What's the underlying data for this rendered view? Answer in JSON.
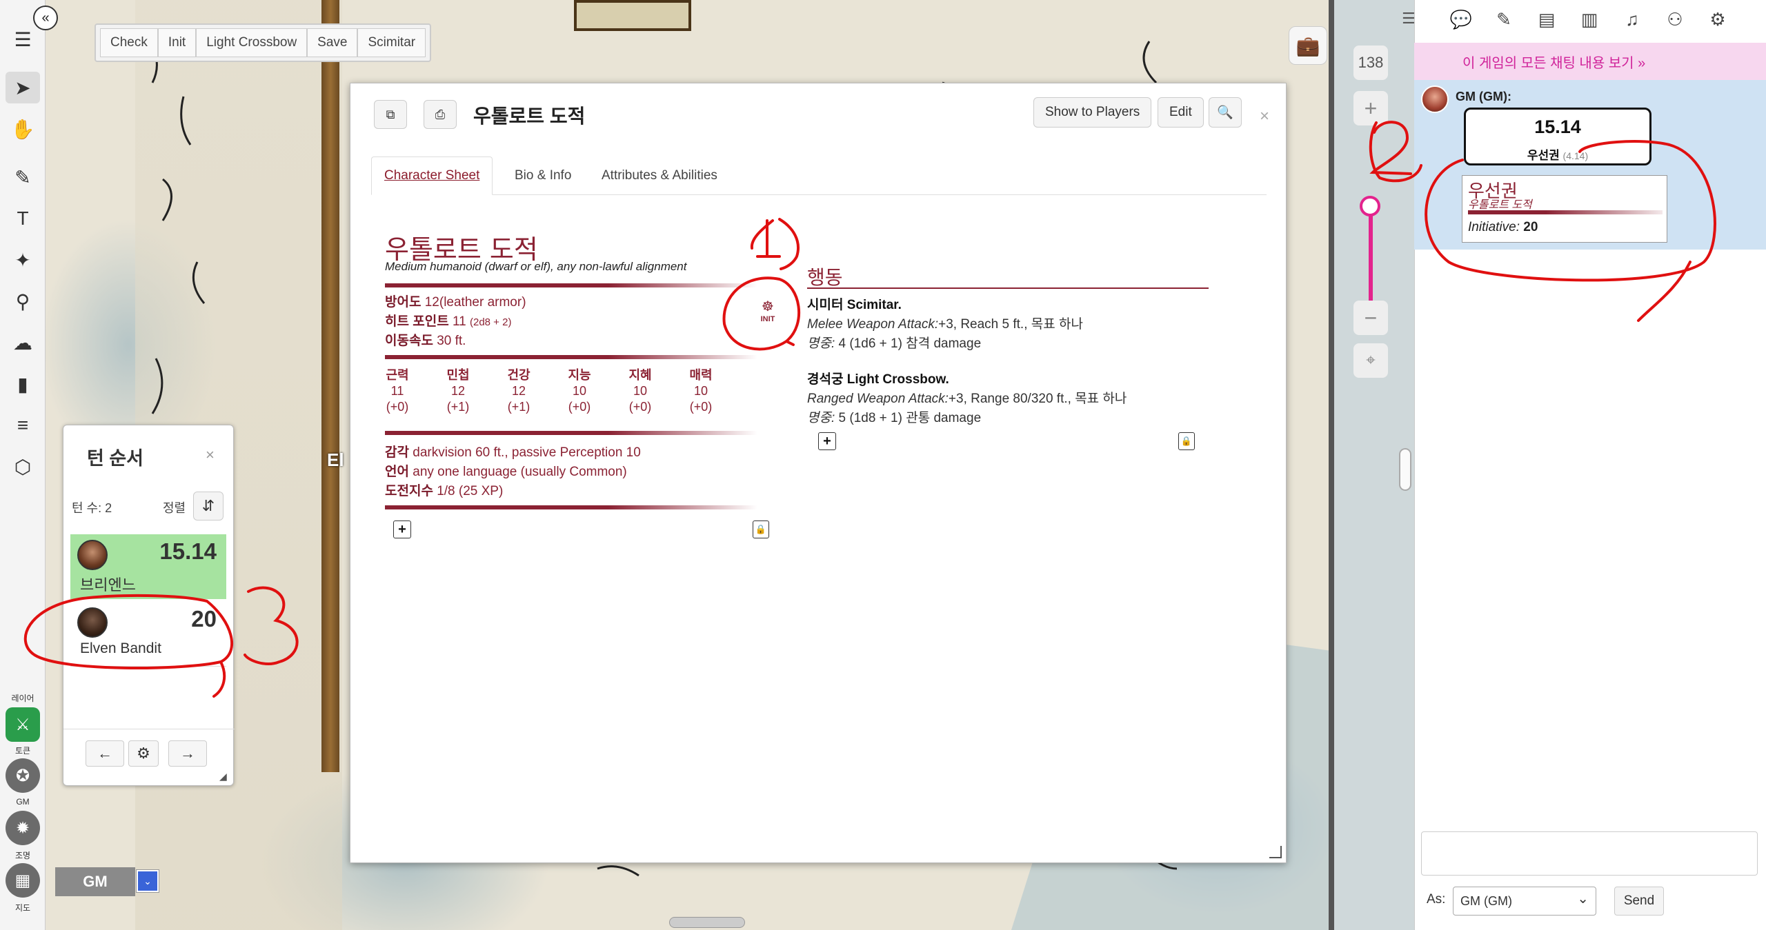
{
  "macros": [
    "Check",
    "Init",
    "Light Crossbow",
    "Save",
    "Scimitar"
  ],
  "zoom": "138",
  "layers": {
    "label_top": "레이어",
    "token_label": "토큰",
    "gm_label": "GM",
    "light_label": "조명",
    "map_label": "지도"
  },
  "sheet": {
    "title": "우톨로트 도적",
    "show_btn": "Show to Players",
    "edit_btn": "Edit",
    "tabs": [
      "Character Sheet",
      "Bio & Info",
      "Attributes & Abilities"
    ],
    "npc_name": "우톨로트 도적",
    "npc_type": "Medium humanoid (dwarf or elf), any non-lawful alignment",
    "ac_label": "방어도",
    "ac_value": "12",
    "ac_note": "(leather armor)",
    "hp_label": "히트 포인트",
    "hp_value": "11",
    "hp_note": "(2d8 + 2)",
    "speed_label": "이동속도",
    "speed_value": "30 ft.",
    "init_label": "INIT",
    "abilities": [
      {
        "name": "근력",
        "score": "11",
        "mod": "(+0)"
      },
      {
        "name": "민첩",
        "score": "12",
        "mod": "(+1)"
      },
      {
        "name": "건강",
        "score": "12",
        "mod": "(+1)"
      },
      {
        "name": "지능",
        "score": "10",
        "mod": "(+0)"
      },
      {
        "name": "지혜",
        "score": "10",
        "mod": "(+0)"
      },
      {
        "name": "매력",
        "score": "10",
        "mod": "(+0)"
      }
    ],
    "senses_label": "감각",
    "senses_value": "darkvision 60 ft., passive Perception 10",
    "lang_label": "언어",
    "lang_value": "any one language (usually Common)",
    "cr_label": "도전지수",
    "cr_value": "1/8 (25 XP)",
    "actions_title": "행동",
    "actions": [
      {
        "name": "시미터 Scimitar.",
        "attack_type": "Melee Weapon Attack:",
        "attack_detail": "+3, Reach 5 ft., 목표 하나",
        "hit_label": "명중:",
        "hit_detail": "4 (1d6 + 1) 참격 damage"
      },
      {
        "name": "경석궁 Light Crossbow.",
        "attack_type": "Ranged Weapon Attack:",
        "attack_detail": "+3, Range 80/320 ft., 목표 하나",
        "hit_label": "명중:",
        "hit_detail": "5 (1d8 + 1) 관통 damage"
      }
    ]
  },
  "turn_order": {
    "title": "턴 순서",
    "round_label": "턴 수: 2",
    "sort_label": "정렬",
    "entries": [
      {
        "name": "브리엔느",
        "score": "15.14",
        "current": true
      },
      {
        "name": "Elven Bandit",
        "score": "20",
        "current": false
      }
    ]
  },
  "player": {
    "name": "GM"
  },
  "map_label_fragment": "El",
  "chat": {
    "archive_link": "이 게임의 모든 채팅 내용 보기 »",
    "sender": "GM (GM):",
    "roll_value": "15.14",
    "roll_label": "우선권",
    "roll_formula": "(4.14)",
    "card_title": "우선권",
    "card_sub": "우톨로트 도적",
    "card_init_label": "Initiative:",
    "card_init_value": "20",
    "as_label": "As:",
    "as_value": "GM (GM)",
    "send_label": "Send"
  },
  "annotations": [
    "1",
    "2",
    "3"
  ],
  "colors": {
    "accent_maroon": "#8b2233",
    "chat_pink": "#d0239a",
    "current_turn": "#a6e3a0",
    "zoom_pink": "#e3238d"
  }
}
